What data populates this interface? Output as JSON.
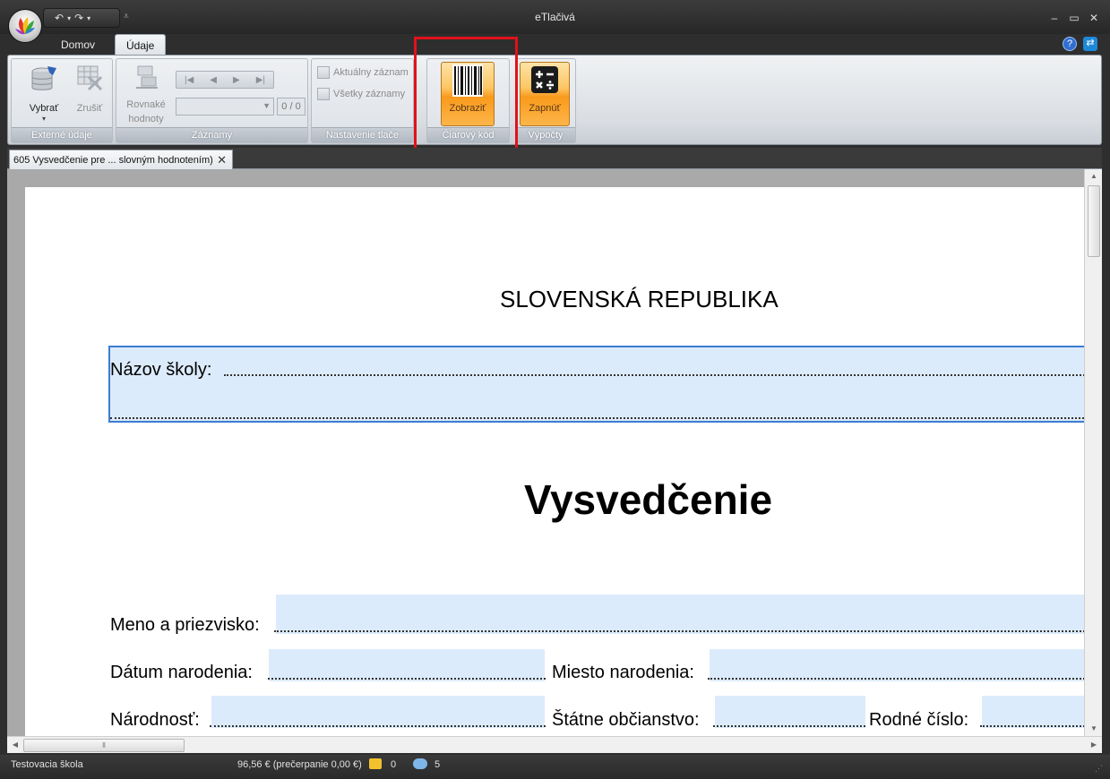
{
  "window": {
    "title": "eTlačivá"
  },
  "quick_access": {
    "undo": "↶",
    "redo": "↷"
  },
  "ribbon_tabs": [
    {
      "label": "Domov",
      "active": false
    },
    {
      "label": "Údaje",
      "active": true
    }
  ],
  "groups": {
    "external": {
      "label": "Externé údaje",
      "select_label": "Vybrať",
      "cancel_label": "Zrušiť"
    },
    "records": {
      "label": "Záznamy",
      "same_values_label_1": "Rovnaké",
      "same_values_label_2": "hodnoty",
      "counter": "0 / 0"
    },
    "print_settings": {
      "label": "Nastavenie tlače",
      "current_record": "Aktuálny záznam",
      "all_records": "Všetky záznamy"
    },
    "barcode": {
      "label": "Čiarový kód",
      "show_label": "Zobraziť"
    },
    "calculations": {
      "label": "Výpočty",
      "enable_label": "Zapnúť"
    }
  },
  "document_tab": {
    "title": "605 Vysvedčenie pre ... slovným hodnotením)",
    "close": "✕"
  },
  "document": {
    "header": "SLOVENSKÁ REPUBLIKA",
    "school_label": "Názov školy:",
    "title": "Vysvedčenie",
    "name_label": "Meno a priezvisko:",
    "birth_date_label": "Dátum narodenia:",
    "birth_place_label": "Miesto narodenia:",
    "nationality_label": "Národnosť:",
    "citizenship_label": "Štátne občianstvo:",
    "birth_number_label": "Rodné číslo:"
  },
  "status": {
    "school": "Testovacia škola",
    "credit": "96,56 € (prečerpanie 0,00 €)",
    "packages": "0",
    "messages": "5"
  },
  "colors": {
    "highlight": "#e0121b",
    "orange_button": "#f99a1c",
    "field_fill": "#dcebfb",
    "field_border": "#3c7dd1"
  }
}
